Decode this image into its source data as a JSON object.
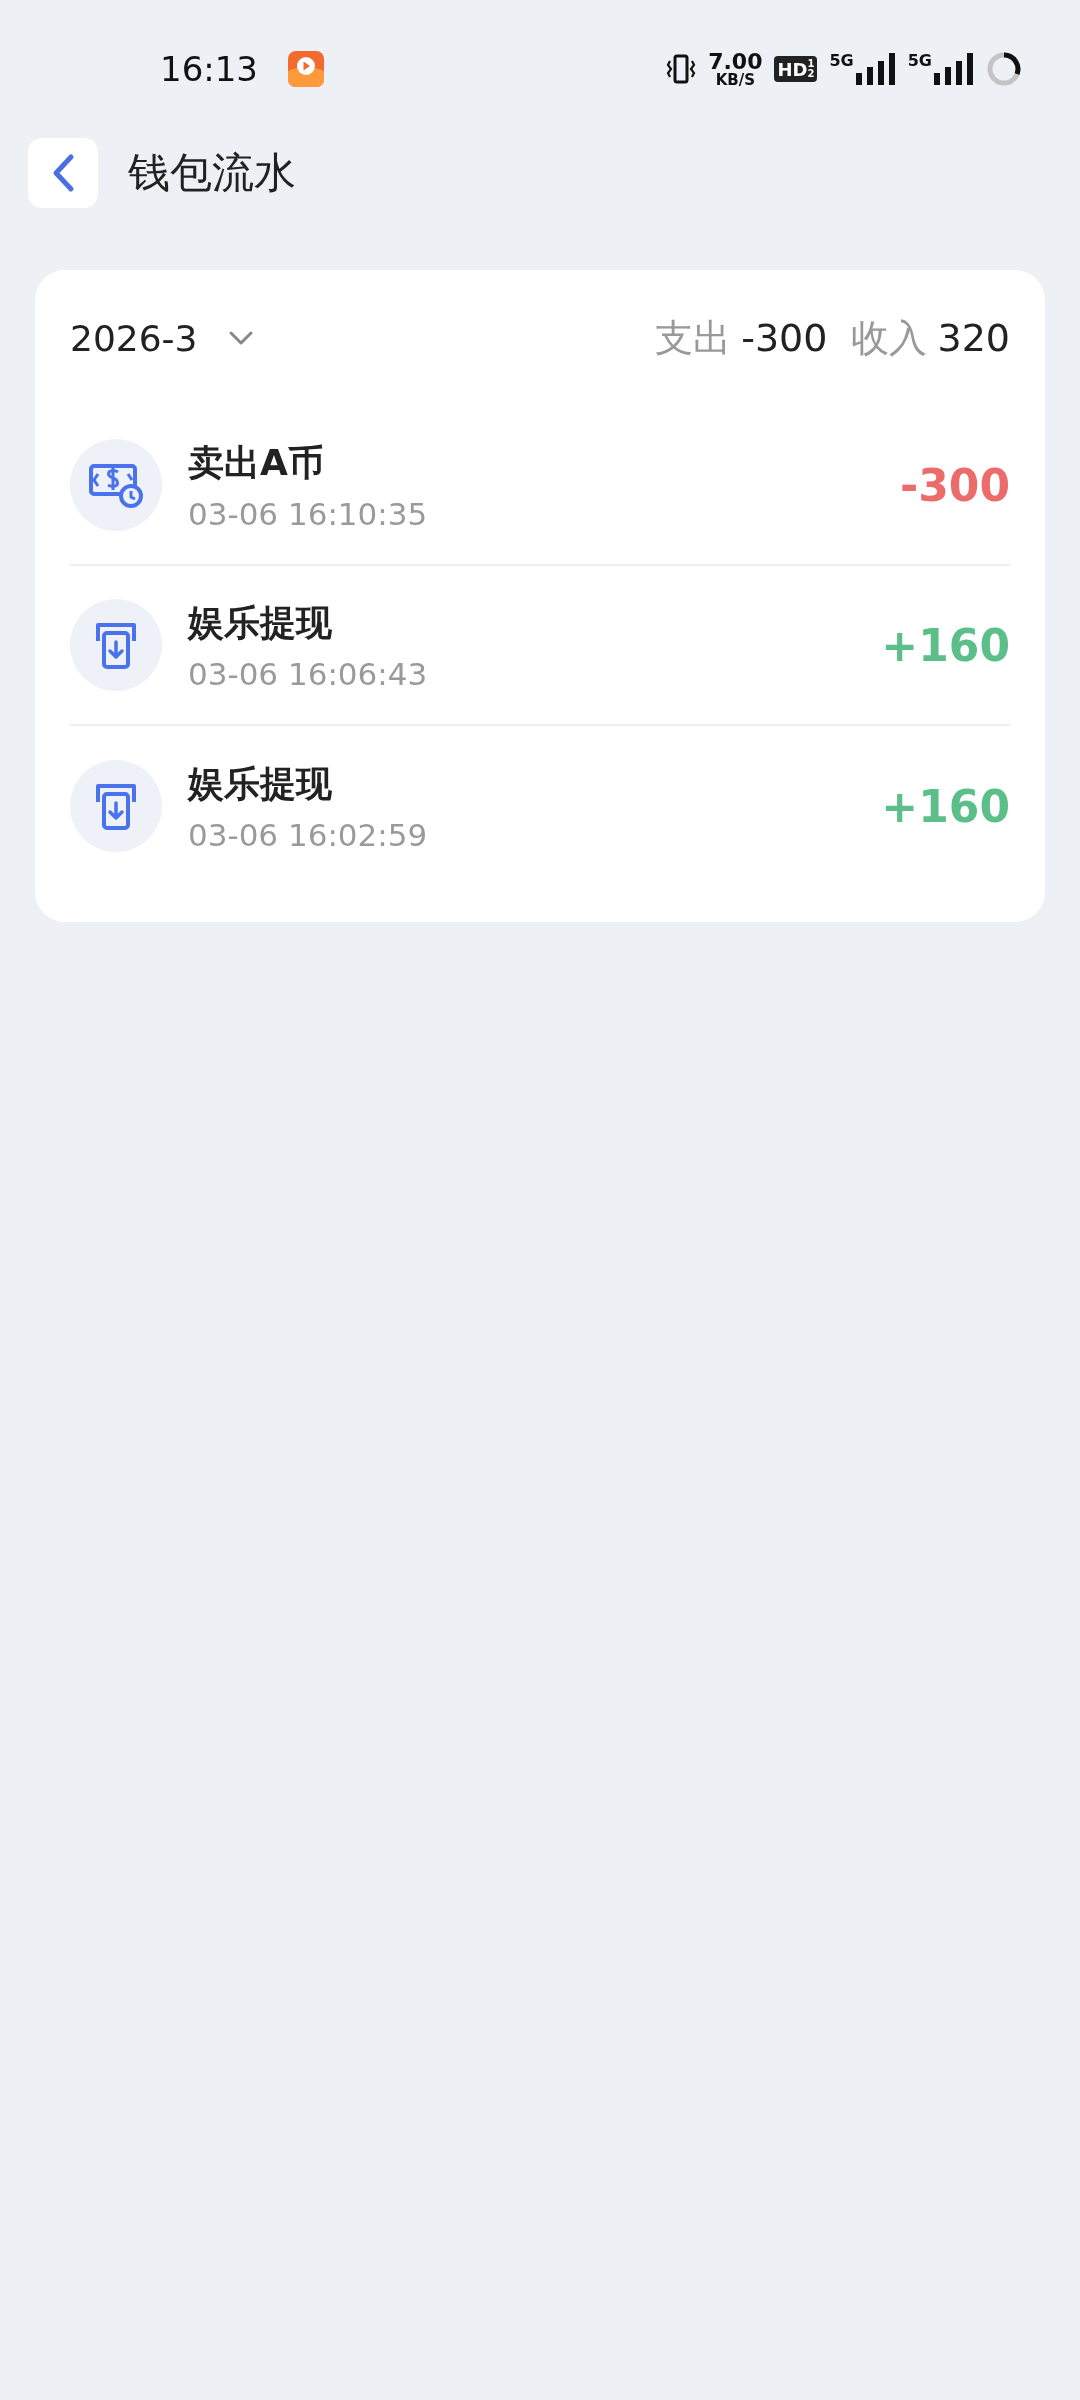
{
  "status_bar": {
    "time": "16:13",
    "speed_value": "7.00",
    "speed_unit": "KB/S",
    "hd_label": "HD",
    "hd_sup": "1",
    "hd_sub": "2",
    "networks": [
      "5G",
      "5G"
    ]
  },
  "header": {
    "title": "钱包流水"
  },
  "summary": {
    "month": "2026-3",
    "expense_label": "支出",
    "expense_value": "-300",
    "income_label": "收入",
    "income_value": "320"
  },
  "records": [
    {
      "kind": "expense",
      "title": "卖出A币",
      "time": "03-06 16:10:35",
      "amount": "-300"
    },
    {
      "kind": "income",
      "title": "娱乐提现",
      "time": "03-06 16:06:43",
      "amount": "+160"
    },
    {
      "kind": "income",
      "title": "娱乐提现",
      "time": "03-06 16:02:59",
      "amount": "+160"
    }
  ]
}
